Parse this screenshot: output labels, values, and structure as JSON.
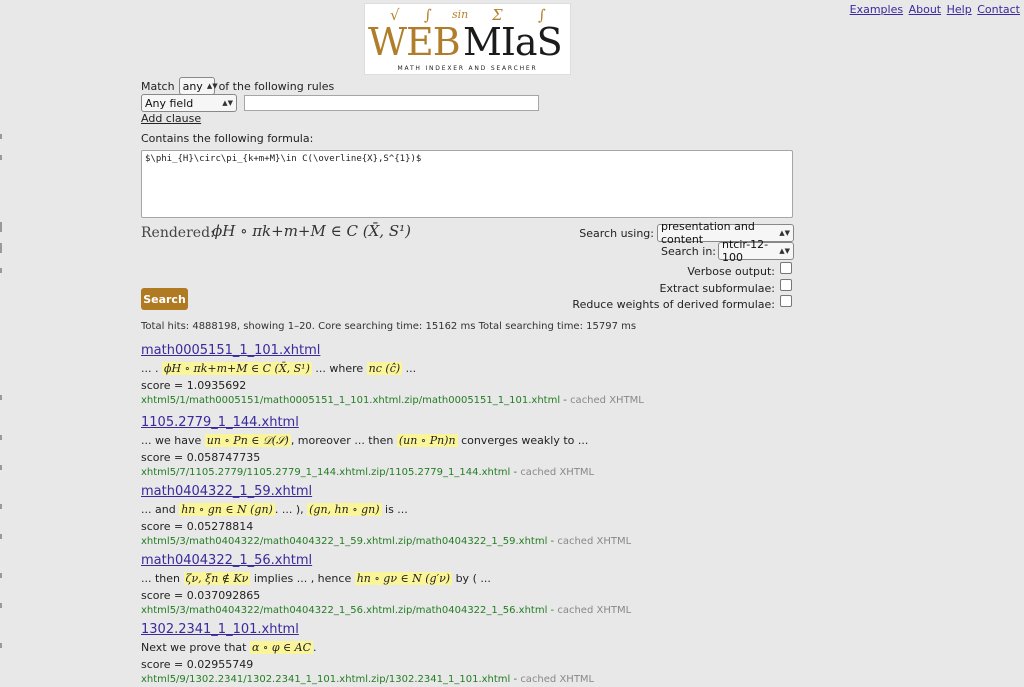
{
  "nav": {
    "links": [
      "Examples",
      "About",
      "Help",
      "Contact"
    ]
  },
  "logo": {
    "symbols": [
      "√",
      "∫",
      "sin",
      "Σ",
      "∫"
    ],
    "word_part1": "WEB",
    "word_part2": "MIaS",
    "tagline": "MATH INDEXER AND SEARCHER"
  },
  "form": {
    "match_label": "Match",
    "match_value": "any",
    "match_suffix": "of the following rules",
    "field_value": "Any field",
    "text_value": "",
    "add_clause": "Add clause",
    "formula_label": "Contains the following formula:",
    "formula_value": "$\\phi_{H}\\circ\\pi_{k+m+M}\\in C(\\overline{X},S^{1})$",
    "rendered_label": "Rendered:",
    "rendered_math": "ϕH ∘ πk+m+M ∈ C (X̄, S¹)",
    "search_using_label": "Search using:",
    "search_using_value": "presentation and content",
    "search_in_label": "Search in:",
    "search_in_value": "ntcir-12-100",
    "verbose_label": "Verbose output:",
    "extract_label": "Extract subformulae:",
    "reduce_label": "Reduce weights of derived formulae:",
    "search_button": "Search"
  },
  "stats": "Total hits: 4888198, showing 1–20. Core searching time: 15162 ms Total searching time: 15797 ms",
  "results": [
    {
      "title": "math0005151_1_101.xhtml",
      "s1": "... .",
      "m1": "ϕH ∘ πk+m+M ∈ C (X̄, S¹)",
      "s2": "... where",
      "m2": "nc (ĉ)",
      "s3": "...",
      "score": "score = 1.0935692",
      "url": "xhtml5/1/math0005151/math0005151_1_101.xhtml.zip/math0005151_1_101.xhtml",
      "cached": "cached XHTML"
    },
    {
      "title": "1105.2779_1_144.xhtml",
      "s1": "... we have",
      "m1": "un ∘ Pn ∈ 𝒟(𝒮)",
      "s2": ", moreover ... then",
      "m2": "(un ∘ Pn)n",
      "s3": "converges weakly to ...",
      "score": "score = 0.058747735",
      "url": "xhtml5/7/1105.2779/1105.2779_1_144.xhtml.zip/1105.2779_1_144.xhtml",
      "cached": "cached XHTML"
    },
    {
      "title": "math0404322_1_59.xhtml",
      "s1": "... and",
      "m1": "hn ∘ gn ∈ N (gn)",
      "s2": ". ... ),",
      "m2": "(gn, hn ∘ gn)",
      "s3": "is ...",
      "score": "score = 0.05278814",
      "url": "xhtml5/3/math0404322/math0404322_1_59.xhtml.zip/math0404322_1_59.xhtml",
      "cached": "cached XHTML"
    },
    {
      "title": "math0404322_1_56.xhtml",
      "s1": "... then",
      "m1": "ζν, ξn ∉ Kν",
      "s2": "implies ... , hence",
      "m2": "hn ∘ gν ∈ N (g′ν)",
      "s3": "by ( ...",
      "score": "score = 0.037092865",
      "url": "xhtml5/3/math0404322/math0404322_1_56.xhtml.zip/math0404322_1_56.xhtml",
      "cached": "cached XHTML"
    },
    {
      "title": "1302.2341_1_101.xhtml",
      "s1": "Next we prove that",
      "m1": "α ∘ φ ∈ AC",
      "s2": ".",
      "m2": "",
      "s3": "",
      "score": "score = 0.02955749",
      "url": "xhtml5/9/1302.2341/1302.2341_1_101.xhtml.zip/1302.2341_1_101.xhtml",
      "cached": "cached XHTML"
    }
  ]
}
